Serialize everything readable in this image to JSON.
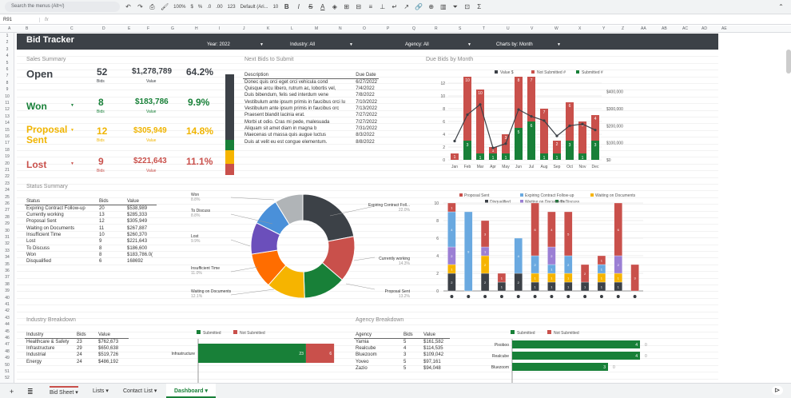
{
  "toolbar": {
    "search_placeholder": "Search the menus (Alt+/)",
    "zoom": "100%",
    "currency": "$",
    "percent": "%",
    "decimal_down": ".0",
    "decimal_up": ".00",
    "number_format": "123",
    "font": "Default (Ari...",
    "font_size": "10"
  },
  "formula_bar": {
    "cell_ref": "R91",
    "fx": "fx"
  },
  "columns": [
    "A",
    "B",
    "C",
    "D",
    "E",
    "F",
    "G",
    "H",
    "I",
    "J",
    "K",
    "L",
    "M",
    "N",
    "O",
    "P",
    "Q",
    "R",
    "S",
    "T",
    "U",
    "V",
    "W",
    "X",
    "Y",
    "Z",
    "AA",
    "AB",
    "AC",
    "AD",
    "AE"
  ],
  "rows": [
    "1",
    "2",
    "3",
    "4",
    "5",
    "6",
    "7",
    "8",
    "9",
    "10",
    "11",
    "12",
    "13",
    "14",
    "15",
    "16",
    "17",
    "18",
    "19",
    "20",
    "21",
    "22",
    "23",
    "24",
    "25",
    "26",
    "27",
    "28",
    "29",
    "30",
    "31",
    "32",
    "33",
    "34",
    "35",
    "36",
    "37",
    "38",
    "39",
    "40",
    "41",
    "42",
    "43",
    "44",
    "45",
    "46",
    "47",
    "48",
    "49",
    "50",
    "51",
    "52"
  ],
  "header": {
    "title": "Bid Tracker",
    "year": "Year: 2022",
    "industry": "Industry: All",
    "agency": "Agency: All",
    "charts_by": "Charts by: Month"
  },
  "sales_summary": {
    "title": "Sales Summary",
    "items": [
      {
        "label": "Open",
        "bids": "52",
        "bids_label": "Bids",
        "value": "$1,278,789",
        "value_label": "Value",
        "pct": "64.2%",
        "color": "#3c4147"
      },
      {
        "label": "Won",
        "bids": "8",
        "bids_label": "Bids",
        "value": "$183,786",
        "value_label": "Value",
        "pct": "9.9%",
        "color": "#188038"
      },
      {
        "label": "Proposal\nSent",
        "bids": "12",
        "bids_label": "Bids",
        "value": "$305,949",
        "value_label": "Value",
        "pct": "14.8%",
        "color": "#f0b400"
      },
      {
        "label": "Lost",
        "bids": "9",
        "bids_label": "Bids",
        "value": "$221,643",
        "value_label": "Value",
        "pct": "11.1%",
        "color": "#c9504b"
      }
    ]
  },
  "next_bids": {
    "title": "Next Bids to Submit",
    "headers": [
      "Description",
      "Due Date"
    ],
    "rows": [
      [
        "Donec quis orci eget orci vehicula cond",
        "6/27/2022"
      ],
      [
        "Quisque arcu libero, rutrum ac, lobortis vel,",
        "7/4/2022"
      ],
      [
        "Duis bibendum, felis sed interdum vene",
        "7/8/2022"
      ],
      [
        "Vestibulum ante ipsum primis in faucibus orci lu",
        "7/10/2022"
      ],
      [
        "Vestibulum ante ipsum primis in faucibus orc",
        "7/13/2022"
      ],
      [
        "Praesent blandit lacinia erat.",
        "7/27/2022"
      ],
      [
        "Morbi ut odio. Cras mi pede, malesuada",
        "7/27/2022"
      ],
      [
        "Aliquam sit amet diam in magna b",
        "7/31/2022"
      ],
      [
        "Maecenas ut massa quis augue luctus",
        "8/3/2022"
      ],
      [
        "Duis at velit eu est congue elementum.",
        "8/8/2022"
      ]
    ]
  },
  "status_summary": {
    "title": "Status Summary",
    "headers": [
      "Status",
      "Bids",
      "Value"
    ],
    "rows": [
      [
        "Expiring Contract Follow-up",
        "20",
        "$538,989"
      ],
      [
        "Currently working",
        "13",
        "$285,333"
      ],
      [
        "Proposal Sent",
        "12",
        "$305,949"
      ],
      [
        "Waiting on Documents",
        "11",
        "$267,887"
      ],
      [
        "Insufficient Time",
        "10",
        "$260,370"
      ],
      [
        "Lost",
        "9",
        "$221,643"
      ],
      [
        "To Discuss",
        "8",
        "$186,600"
      ],
      [
        "Won",
        "8",
        "$183,786.0("
      ],
      [
        "Disqualified",
        "6",
        "168692"
      ]
    ]
  },
  "donut": {
    "labels": [
      {
        "name": "Won",
        "pct": "8.8%"
      },
      {
        "name": "To Discuss",
        "pct": "8.8%"
      },
      {
        "name": "Lost",
        "pct": "9.9%"
      },
      {
        "name": "Insufficient Time",
        "pct": "11.0%"
      },
      {
        "name": "Waiting on Documents",
        "pct": "12.1%"
      },
      {
        "name": "Proposal Sent",
        "pct": "13.2%"
      },
      {
        "name": "Currently working",
        "pct": "14.3%"
      },
      {
        "name": "Expiring Contract Foll...",
        "pct": "22.0%"
      }
    ]
  },
  "industry": {
    "title": "Industry Breakdown",
    "headers": [
      "Industry",
      "Bids",
      "Value"
    ],
    "rows": [
      [
        "Healthcare & Safety",
        "23",
        "$762,673"
      ],
      [
        "Infrastructure",
        "29",
        "$650,638"
      ],
      [
        "Industrial",
        "24",
        "$519,726"
      ],
      [
        "Energy",
        "24",
        "$486,192"
      ]
    ]
  },
  "agency": {
    "title": "Agency Breakdown",
    "headers": [
      "Agency",
      "Bids",
      "Value"
    ],
    "rows": [
      [
        "Yamia",
        "5",
        "$161,582"
      ],
      [
        "Realcube",
        "4",
        "$114,535"
      ],
      [
        "Bluezoom",
        "3",
        "$109,042"
      ],
      [
        "Yoveo",
        "5",
        "$97,161"
      ],
      [
        "Zazio",
        "5",
        "$94,048"
      ]
    ]
  },
  "tabs": [
    "Bid Sheet",
    "Lists",
    "Contact List",
    "Dashboard"
  ],
  "chart_data": [
    {
      "type": "bar",
      "title": "Due Bids by Month",
      "categories": [
        "Jan",
        "Feb",
        "Mar",
        "Apr",
        "May",
        "Jun",
        "Jul",
        "Aug",
        "Sep",
        "Oct",
        "Nov",
        "Dec"
      ],
      "series": [
        {
          "name": "Value $",
          "kind": "line",
          "values": [
            110000,
            265000,
            325000,
            70000,
            95000,
            295000,
            255000,
            230000,
            140000,
            200000,
            210000,
            175000
          ]
        },
        {
          "name": "Not Submitted #",
          "values": [
            1,
            10,
            10,
            1,
            3,
            8,
            7,
            7,
            2,
            6,
            5,
            4
          ]
        },
        {
          "name": "Submitted #",
          "values": [
            0,
            3,
            1,
            1,
            1,
            5,
            6,
            1,
            1,
            3,
            1,
            3
          ]
        }
      ],
      "y_left": [
        0,
        2,
        4,
        6,
        8,
        10,
        12
      ],
      "y_right": [
        "$0",
        "$100,000",
        "$200,000",
        "$300,000",
        "$400,000"
      ],
      "colors": {
        "line": "#3c4147",
        "not_submitted": "#c9504b",
        "submitted": "#188038"
      }
    },
    {
      "type": "pie",
      "kind": "donut",
      "values": [
        8.8,
        8.8,
        9.9,
        11.0,
        12.1,
        13.2,
        14.3,
        22.0
      ],
      "categories": [
        "Won",
        "To Discuss",
        "Lost",
        "Insufficient Time",
        "Waiting on Documents",
        "Proposal Sent",
        "Currently working",
        "Expiring Contract Foll..."
      ],
      "colors": [
        "#b0b4b7",
        "#4a90d9",
        "#6b4fbb",
        "#ff6d00",
        "#f6b400",
        "#188038",
        "#c9504b",
        "#3c4147"
      ]
    },
    {
      "type": "bar",
      "stacked": true,
      "legend": [
        "Proposal Sent",
        "Expiring Contract Follow-up",
        "Waiting on Documents",
        "Disqualified",
        "To Discuss",
        "Waiting on Documents"
      ],
      "stacks": [
        [
          [
            "#c9504b",
            1
          ],
          [
            "#6aa9e0",
            4
          ],
          [
            "#9b7fd4",
            2
          ],
          [
            "#f6b400",
            1
          ],
          [
            "#3c4147",
            2
          ]
        ],
        [
          [
            "#6aa9e0",
            9
          ]
        ],
        [
          [
            "#c9504b",
            3
          ],
          [
            "#9b7fd4",
            1
          ],
          [
            "#f6b400",
            2
          ],
          [
            "#3c4147",
            2
          ]
        ],
        [
          [
            "#c9504b",
            1
          ],
          [
            "#3c4147",
            1
          ]
        ],
        [
          [
            "#6aa9e0",
            4
          ],
          [
            "#3c4147",
            2
          ]
        ],
        [
          [
            "#c9504b",
            6
          ],
          [
            "#6aa9e0",
            2
          ],
          [
            "#f6b400",
            1
          ],
          [
            "#3c4147",
            1
          ]
        ],
        [
          [
            "#c9504b",
            4
          ],
          [
            "#9b7fd4",
            2
          ],
          [
            "#6aa9e0",
            1
          ],
          [
            "#f6b400",
            1
          ],
          [
            "#3c4147",
            1
          ]
        ],
        [
          [
            "#c9504b",
            5
          ],
          [
            "#6aa9e0",
            2
          ],
          [
            "#f6b400",
            1
          ],
          [
            "#3c4147",
            1
          ]
        ],
        [
          [
            "#c9504b",
            2
          ],
          [
            "#3c4147",
            1
          ]
        ],
        [
          [
            "#c9504b",
            1
          ],
          [
            "#6aa9e0",
            1
          ],
          [
            "#f6b400",
            1
          ],
          [
            "#3c4147",
            1
          ]
        ],
        [
          [
            "#c9504b",
            6
          ],
          [
            "#9b7fd4",
            2
          ],
          [
            "#f6b400",
            1
          ],
          [
            "#3c4147",
            1
          ]
        ],
        [
          [
            "#c9504b",
            3
          ]
        ]
      ],
      "bottom_labels": [
        "1",
        "1",
        "1",
        "1",
        "1",
        "3",
        "1",
        "1",
        "1",
        "1",
        "1",
        "1"
      ],
      "y": [
        0,
        2,
        4,
        6,
        8,
        10
      ]
    },
    {
      "type": "bar",
      "orientation": "horizontal",
      "legend": [
        "Submitted",
        "Not Submitted"
      ],
      "categories": [
        "Infrastructure"
      ],
      "series": [
        {
          "name": "Submitted",
          "values": [
            23
          ]
        },
        {
          "name": "Not Submitted",
          "values": [
            6
          ]
        }
      ]
    },
    {
      "type": "bar",
      "orientation": "horizontal",
      "legend": [
        "Submitted",
        "Not Submitted"
      ],
      "categories": [
        "Pixoboo",
        "Realcube",
        "Bluezoom"
      ],
      "series": [
        {
          "name": "Submitted",
          "values": [
            4,
            4,
            3
          ]
        },
        {
          "name": "Not Submitted",
          "values": [
            0,
            0,
            0
          ]
        }
      ]
    }
  ]
}
